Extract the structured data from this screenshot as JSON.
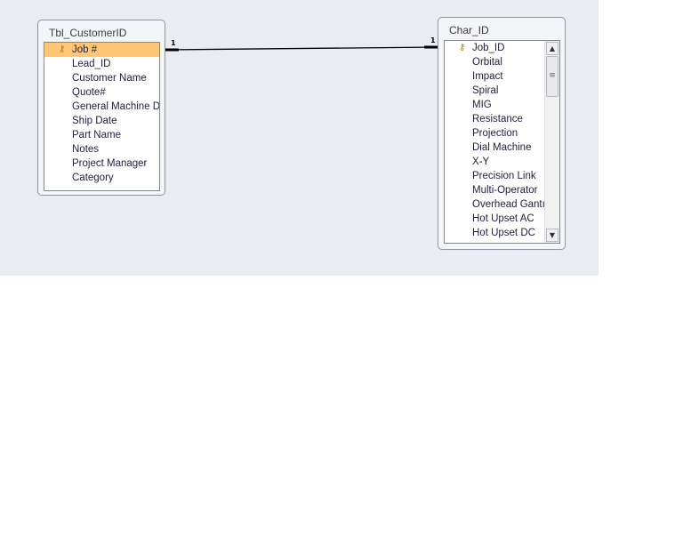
{
  "tables": [
    {
      "title": "Tbl_CustomerID",
      "fields": [
        "Job #",
        "Lead_ID",
        "Customer Name",
        "Quote#",
        "General Machine D",
        "Ship Date",
        "Part Name",
        "Notes",
        "Project Manager",
        "Category"
      ]
    },
    {
      "title": "Char_ID",
      "fields": [
        "Job_ID",
        "Orbital",
        "Impact",
        "Spiral",
        "MIG",
        "Resistance",
        "Projection",
        "Dial Machine",
        "X-Y",
        "Precision Link",
        "Multi-Operator",
        "Overhead Gantı",
        "Hot Upset AC",
        "Hot Upset DC"
      ]
    }
  ],
  "relationship": {
    "left_cardinality": "1",
    "right_cardinality": "1"
  },
  "colors": {
    "selected_row": "#ffc774",
    "canvas": "#e9edf1"
  }
}
